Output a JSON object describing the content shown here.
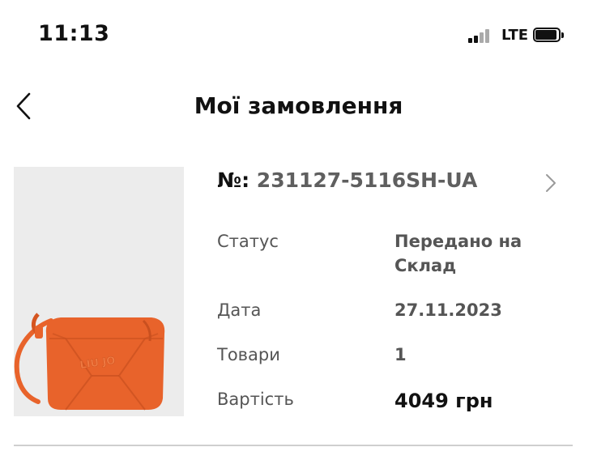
{
  "status_bar": {
    "time": "11:13",
    "network": "LTE",
    "signal_icon": "cellular-signal-icon",
    "battery_icon": "battery-icon"
  },
  "header": {
    "back_icon": "chevron-left-icon",
    "title": "Мої замовлення"
  },
  "order": {
    "number_prefix": "№:",
    "number": "231127-5116SH-UA",
    "chevron_icon": "chevron-right-icon",
    "image_brand_text": "LIU JO",
    "rows": [
      {
        "label": "Статус",
        "value": "Передано на Склад"
      },
      {
        "label": "Дата",
        "value": "27.11.2023"
      },
      {
        "label": "Товари",
        "value": "1"
      },
      {
        "label": "Вартість",
        "value": "4049 грн"
      }
    ]
  },
  "colors": {
    "product_orange": "#e8632b",
    "image_background": "#ececec",
    "muted_text": "#555555",
    "divider": "#cfcfcf"
  }
}
